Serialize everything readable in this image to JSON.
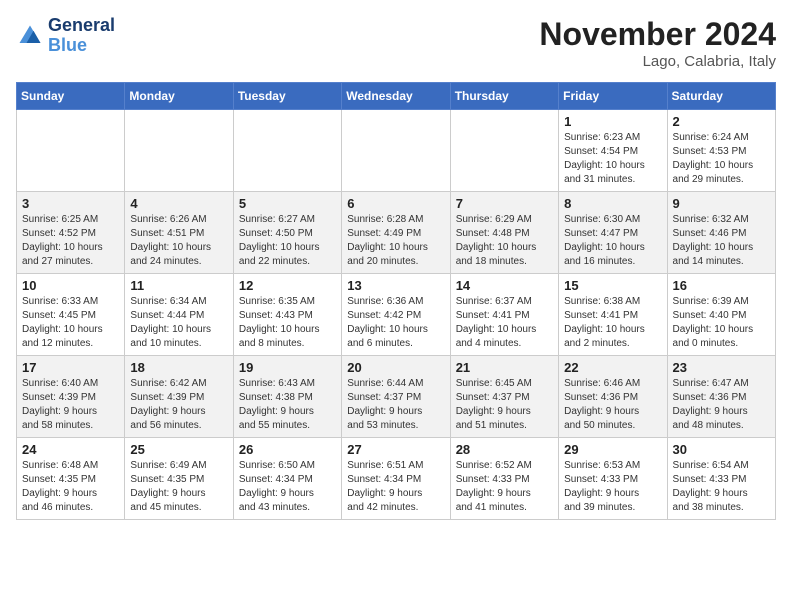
{
  "header": {
    "logo_line1": "General",
    "logo_line2": "Blue",
    "month_title": "November 2024",
    "subtitle": "Lago, Calabria, Italy"
  },
  "days_of_week": [
    "Sunday",
    "Monday",
    "Tuesday",
    "Wednesday",
    "Thursday",
    "Friday",
    "Saturday"
  ],
  "weeks": [
    [
      {
        "day": "",
        "info": ""
      },
      {
        "day": "",
        "info": ""
      },
      {
        "day": "",
        "info": ""
      },
      {
        "day": "",
        "info": ""
      },
      {
        "day": "",
        "info": ""
      },
      {
        "day": "1",
        "info": "Sunrise: 6:23 AM\nSunset: 4:54 PM\nDaylight: 10 hours\nand 31 minutes."
      },
      {
        "day": "2",
        "info": "Sunrise: 6:24 AM\nSunset: 4:53 PM\nDaylight: 10 hours\nand 29 minutes."
      }
    ],
    [
      {
        "day": "3",
        "info": "Sunrise: 6:25 AM\nSunset: 4:52 PM\nDaylight: 10 hours\nand 27 minutes."
      },
      {
        "day": "4",
        "info": "Sunrise: 6:26 AM\nSunset: 4:51 PM\nDaylight: 10 hours\nand 24 minutes."
      },
      {
        "day": "5",
        "info": "Sunrise: 6:27 AM\nSunset: 4:50 PM\nDaylight: 10 hours\nand 22 minutes."
      },
      {
        "day": "6",
        "info": "Sunrise: 6:28 AM\nSunset: 4:49 PM\nDaylight: 10 hours\nand 20 minutes."
      },
      {
        "day": "7",
        "info": "Sunrise: 6:29 AM\nSunset: 4:48 PM\nDaylight: 10 hours\nand 18 minutes."
      },
      {
        "day": "8",
        "info": "Sunrise: 6:30 AM\nSunset: 4:47 PM\nDaylight: 10 hours\nand 16 minutes."
      },
      {
        "day": "9",
        "info": "Sunrise: 6:32 AM\nSunset: 4:46 PM\nDaylight: 10 hours\nand 14 minutes."
      }
    ],
    [
      {
        "day": "10",
        "info": "Sunrise: 6:33 AM\nSunset: 4:45 PM\nDaylight: 10 hours\nand 12 minutes."
      },
      {
        "day": "11",
        "info": "Sunrise: 6:34 AM\nSunset: 4:44 PM\nDaylight: 10 hours\nand 10 minutes."
      },
      {
        "day": "12",
        "info": "Sunrise: 6:35 AM\nSunset: 4:43 PM\nDaylight: 10 hours\nand 8 minutes."
      },
      {
        "day": "13",
        "info": "Sunrise: 6:36 AM\nSunset: 4:42 PM\nDaylight: 10 hours\nand 6 minutes."
      },
      {
        "day": "14",
        "info": "Sunrise: 6:37 AM\nSunset: 4:41 PM\nDaylight: 10 hours\nand 4 minutes."
      },
      {
        "day": "15",
        "info": "Sunrise: 6:38 AM\nSunset: 4:41 PM\nDaylight: 10 hours\nand 2 minutes."
      },
      {
        "day": "16",
        "info": "Sunrise: 6:39 AM\nSunset: 4:40 PM\nDaylight: 10 hours\nand 0 minutes."
      }
    ],
    [
      {
        "day": "17",
        "info": "Sunrise: 6:40 AM\nSunset: 4:39 PM\nDaylight: 9 hours\nand 58 minutes."
      },
      {
        "day": "18",
        "info": "Sunrise: 6:42 AM\nSunset: 4:39 PM\nDaylight: 9 hours\nand 56 minutes."
      },
      {
        "day": "19",
        "info": "Sunrise: 6:43 AM\nSunset: 4:38 PM\nDaylight: 9 hours\nand 55 minutes."
      },
      {
        "day": "20",
        "info": "Sunrise: 6:44 AM\nSunset: 4:37 PM\nDaylight: 9 hours\nand 53 minutes."
      },
      {
        "day": "21",
        "info": "Sunrise: 6:45 AM\nSunset: 4:37 PM\nDaylight: 9 hours\nand 51 minutes."
      },
      {
        "day": "22",
        "info": "Sunrise: 6:46 AM\nSunset: 4:36 PM\nDaylight: 9 hours\nand 50 minutes."
      },
      {
        "day": "23",
        "info": "Sunrise: 6:47 AM\nSunset: 4:36 PM\nDaylight: 9 hours\nand 48 minutes."
      }
    ],
    [
      {
        "day": "24",
        "info": "Sunrise: 6:48 AM\nSunset: 4:35 PM\nDaylight: 9 hours\nand 46 minutes."
      },
      {
        "day": "25",
        "info": "Sunrise: 6:49 AM\nSunset: 4:35 PM\nDaylight: 9 hours\nand 45 minutes."
      },
      {
        "day": "26",
        "info": "Sunrise: 6:50 AM\nSunset: 4:34 PM\nDaylight: 9 hours\nand 43 minutes."
      },
      {
        "day": "27",
        "info": "Sunrise: 6:51 AM\nSunset: 4:34 PM\nDaylight: 9 hours\nand 42 minutes."
      },
      {
        "day": "28",
        "info": "Sunrise: 6:52 AM\nSunset: 4:33 PM\nDaylight: 9 hours\nand 41 minutes."
      },
      {
        "day": "29",
        "info": "Sunrise: 6:53 AM\nSunset: 4:33 PM\nDaylight: 9 hours\nand 39 minutes."
      },
      {
        "day": "30",
        "info": "Sunrise: 6:54 AM\nSunset: 4:33 PM\nDaylight: 9 hours\nand 38 minutes."
      }
    ]
  ]
}
